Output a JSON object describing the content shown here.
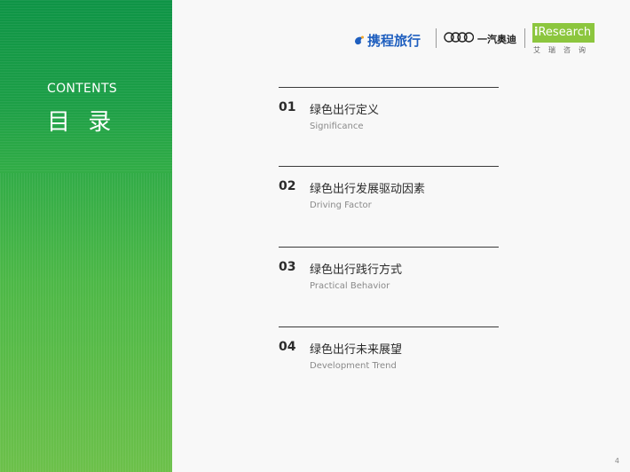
{
  "sidebar": {
    "label": "CONTENTS",
    "title": "目 录"
  },
  "logos": {
    "ctrip": "携程旅行",
    "audi": "一汽奥迪",
    "iresearch_i": "i",
    "iresearch": "Research",
    "iresearch_cn": "艾瑞咨询"
  },
  "toc": [
    {
      "num": "01",
      "title_cn": "绿色出行定义",
      "title_en": "Significance"
    },
    {
      "num": "02",
      "title_cn": "绿色出行发展驱动因素",
      "title_en": "Driving Factor"
    },
    {
      "num": "03",
      "title_cn": "绿色出行践行方式",
      "title_en": "Practical Behavior"
    },
    {
      "num": "04",
      "title_cn": "绿色出行未来展望",
      "title_en": "Development Trend"
    }
  ],
  "page_number": "4",
  "colors": {
    "green_dark": "#0f9a4a",
    "green_light": "#6cc04a",
    "ctrip_blue": "#1f5fbf",
    "iresearch_green": "#8cc63e"
  }
}
